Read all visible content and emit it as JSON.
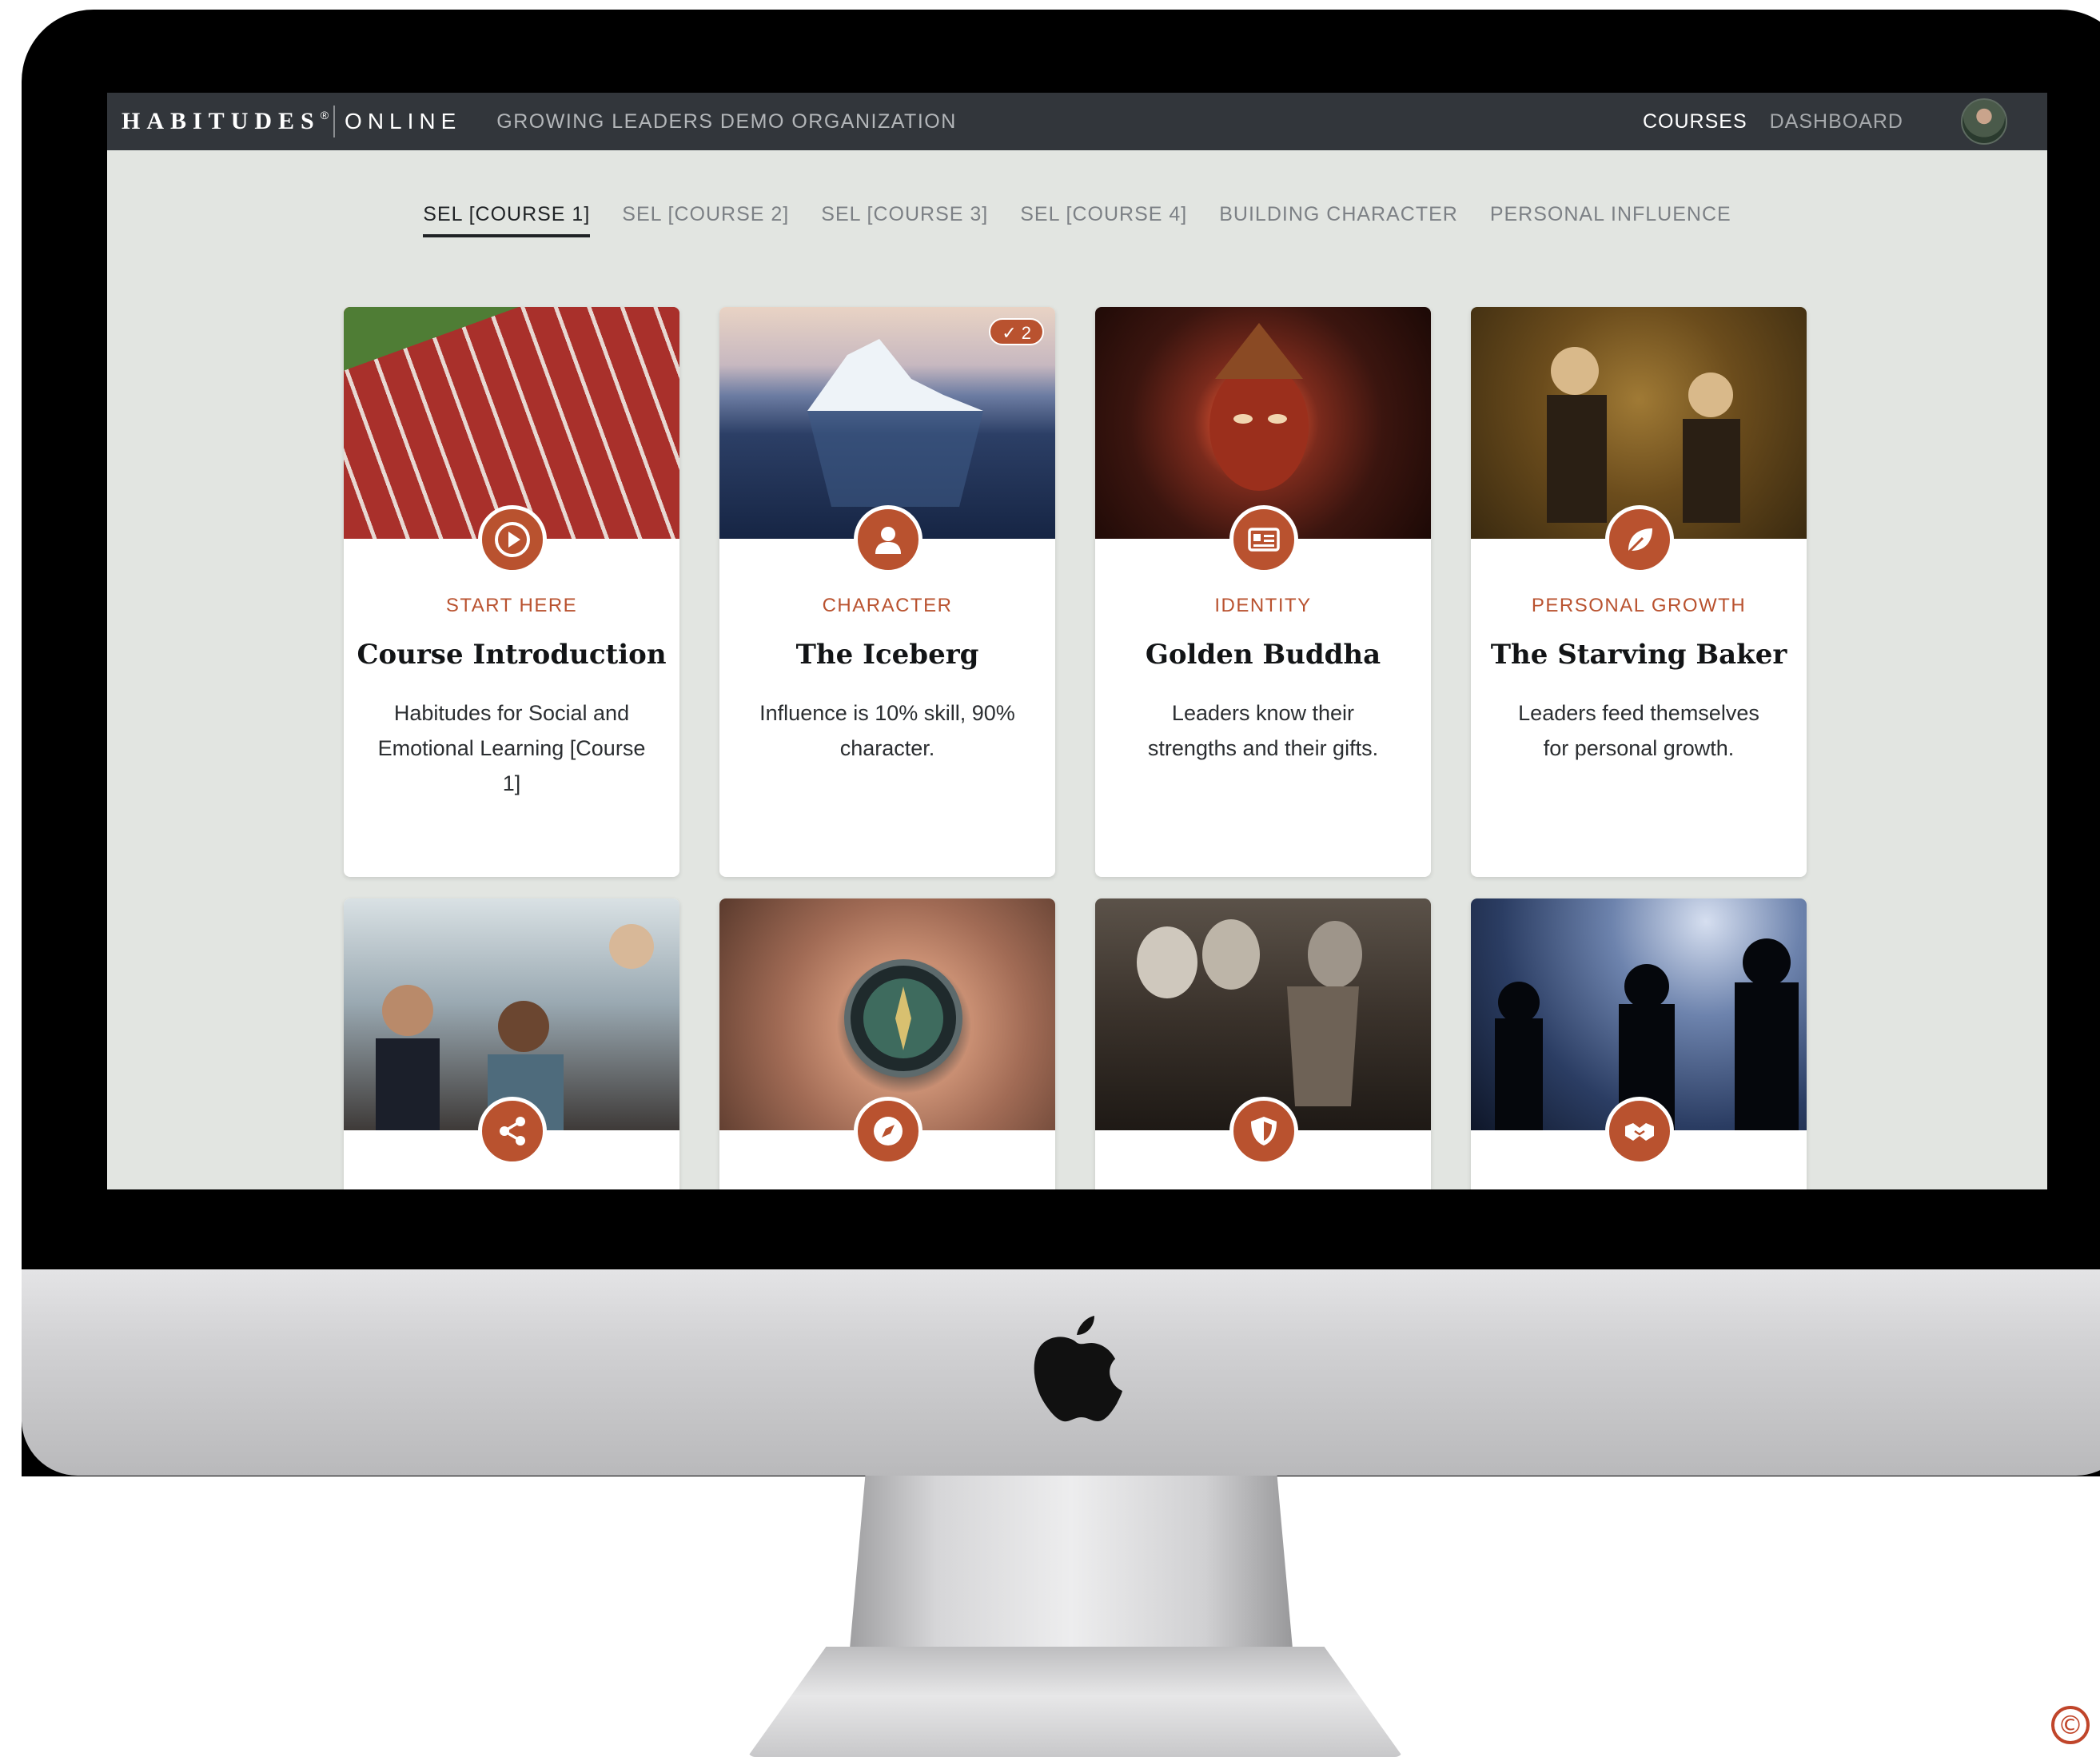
{
  "app": {
    "brand_main": "HABITUDES",
    "brand_reg": "®",
    "brand_sub": "ONLINE",
    "organization": "GROWING LEADERS DEMO ORGANIZATION"
  },
  "nav": {
    "courses": "COURSES",
    "dashboard": "DASHBOARD"
  },
  "tabs": [
    {
      "label": "SEL [COURSE 1]",
      "active": true
    },
    {
      "label": "SEL [COURSE 2]",
      "active": false
    },
    {
      "label": "SEL [COURSE 3]",
      "active": false
    },
    {
      "label": "SEL [COURSE 4]",
      "active": false
    },
    {
      "label": "BUILDING CHARACTER",
      "active": false
    },
    {
      "label": "PERSONAL INFLUENCE",
      "active": false
    }
  ],
  "cards": [
    {
      "category": "START HERE",
      "title": "Course Introduction",
      "description": "Habitudes for Social and Emotional Learning [Course 1]",
      "icon": "play-icon"
    },
    {
      "category": "CHARACTER",
      "title": "The Iceberg",
      "description": "Influence is 10% skill, 90% character.",
      "icon": "user-icon",
      "completed_count": "2"
    },
    {
      "category": "IDENTITY",
      "title": "Golden Buddha",
      "description": "Leaders know their strengths and their gifts.",
      "icon": "id-card-icon"
    },
    {
      "category": "PERSONAL GROWTH",
      "title": "The Starving Baker",
      "description": "Leaders feed themselves for personal growth.",
      "icon": "leaf-icon"
    },
    {
      "icon": "share-icon"
    },
    {
      "icon": "compass-icon"
    },
    {
      "icon": "shield-icon"
    },
    {
      "icon": "handshake-icon"
    }
  ],
  "check_symbol": "✓",
  "copyright_symbol": "©",
  "colors": {
    "accent": "#b9522f",
    "topbar": "#32363b",
    "screen_bg": "#e2e5e1"
  }
}
